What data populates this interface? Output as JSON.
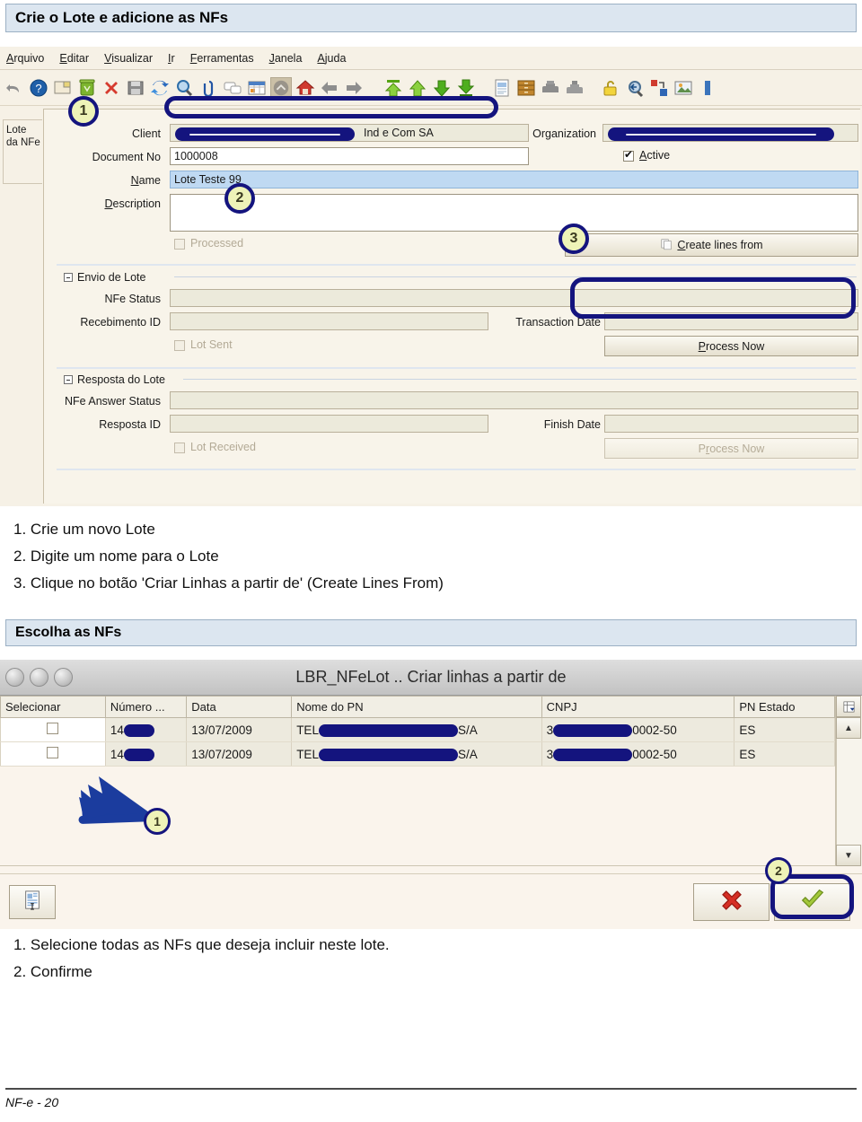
{
  "headings": {
    "first": "Crie o Lote e adicione as NFs",
    "second": "Escolha as NFs"
  },
  "erp_window": {
    "menubar": [
      {
        "pre": "",
        "mnemonic": "A",
        "post": "rquivo"
      },
      {
        "pre": "",
        "mnemonic": "E",
        "post": "ditar"
      },
      {
        "pre": "",
        "mnemonic": "V",
        "post": "isualizar"
      },
      {
        "pre": "",
        "mnemonic": "I",
        "post": "r"
      },
      {
        "pre": "",
        "mnemonic": "F",
        "post": "erramentas"
      },
      {
        "pre": "",
        "mnemonic": "J",
        "post": "anela"
      },
      {
        "pre": "",
        "mnemonic": "A",
        "post": "juda"
      }
    ],
    "toolbar_icons": [
      "undo-icon",
      "help-icon",
      "new-record-icon",
      "delete-record-icon",
      "delete-all-icon",
      "save-icon",
      "refresh-icon",
      "find-icon",
      "attachment-icon",
      "chat-icon",
      "report-icon",
      "home-active-icon",
      "home-icon",
      "back-icon",
      "forward-icon",
      "first-record-icon",
      "previous-record-icon",
      "next-record-icon",
      "last-record-icon",
      "detail-view-icon",
      "archive-icon",
      "print-preview-icon",
      "print-icon",
      "lock-icon",
      "zoom-across-icon",
      "active-workflow-icon",
      "image-icon",
      "info-icon"
    ],
    "tab_label_line1": "Lote",
    "tab_label_line2": "da NFe",
    "fields": {
      "client_label": "Client",
      "client_suffix": "Ind e Com SA",
      "organization_label": "Organization",
      "document_no_label": "Document No",
      "document_no_value": "1000008",
      "name_label": "Name",
      "name_mnemonic": "N",
      "name_value": "Lote Teste 99",
      "description_label": "Description",
      "description_mnemonic": "D",
      "description_value": "",
      "processed_label": "Processed",
      "active_label": "Active",
      "active_mnemonic": "A",
      "active_checked": true,
      "create_lines_button": "Create lines from",
      "create_lines_mnemonic": "C"
    },
    "group_envio": {
      "title": "Envio de Lote",
      "nfe_status_label": "NFe Status",
      "nfe_status_value": "",
      "recebimento_id_label": "Recebimento ID",
      "recebimento_id_value": "",
      "transaction_date_label": "Transaction Date",
      "transaction_date_value": "",
      "lot_sent_label": "Lot Sent",
      "process_now_label": "Process Now",
      "process_now_mnemonic": "P"
    },
    "group_resposta": {
      "title": "Resposta do Lote",
      "answer_status_label": "NFe Answer Status",
      "answer_status_value": "",
      "resposta_id_label": "Resposta ID",
      "resposta_id_value": "",
      "finish_date_label": "Finish Date",
      "finish_date_value": "",
      "lot_received_label": "Lot Received",
      "process_now_label": "Process Now",
      "process_now_mnemonic": "r"
    },
    "callouts": [
      "1",
      "2",
      "3"
    ]
  },
  "steps_first": [
    "1. Crie um novo Lote",
    "2. Digite um nome para o Lote",
    "3. Clique no botão 'Criar Linhas a partir de' (Create Lines From)"
  ],
  "dialog": {
    "title": "LBR_NFeLot .. Criar linhas a partir de",
    "columns": [
      "Selecionar",
      "Número ...",
      "Data",
      "Nome do PN",
      "CNPJ",
      "PN Estado"
    ],
    "rows": [
      {
        "selected": false,
        "numero_prefix": "14",
        "data": "13/07/2009",
        "nome_pn_prefix": "TEL",
        "nome_pn_suffix": "S/A",
        "cnpj_prefix": "3",
        "cnpj_suffix": "0002-50",
        "pn_estado": "ES"
      },
      {
        "selected": false,
        "numero_prefix": "14",
        "data": "13/07/2009",
        "nome_pn_prefix": "TEL",
        "nome_pn_suffix": "S/A",
        "cnpj_prefix": "3",
        "cnpj_suffix": "0002-50",
        "pn_estado": "ES"
      }
    ],
    "footer_icons": [
      "report-icon",
      "cancel-icon",
      "confirm-icon"
    ],
    "callouts": [
      "1",
      "2"
    ],
    "column_picker_icon": "column-picker-icon",
    "scroll_up_icon": "scroll-up-icon",
    "scroll_down_icon": "scroll-down-icon"
  },
  "steps_second": [
    "1. Selecione todas as NFs que deseja incluir neste lote.",
    "2. Confirme"
  ],
  "page_footer": "NF-e - 20",
  "colors": {
    "heading_bg": "#dce6f0",
    "callout_ring": "#14147e",
    "callout_fill": "#eef3b8",
    "redaction": "#14147e",
    "erp_bg": "#f6f1e6",
    "highlight_field": "#bfd9f2"
  }
}
